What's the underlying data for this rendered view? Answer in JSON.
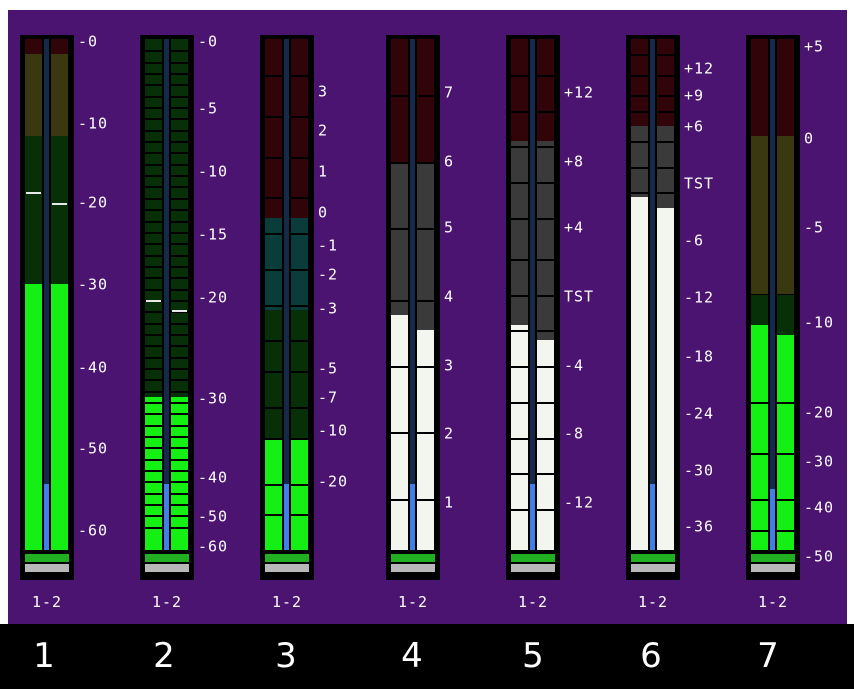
{
  "colors": {
    "background": "#4b1470",
    "footer": "#000000",
    "green_active": "#14f014",
    "white_active": "#f2f6ee",
    "peak_blue": "#3f7fe6",
    "dark_red": "#300408",
    "dark_olive": "#3a3810",
    "dark_green": "#083008",
    "dark_teal": "#0a3c3c",
    "dark_gray": "#3a3a3a"
  },
  "meters": [
    {
      "track": "1",
      "channel_label": "1-2",
      "scale": [
        "-0",
        "-10",
        "-20",
        "-30",
        "-40",
        "-50",
        "-60"
      ],
      "left_level": 0.52,
      "right_level": 0.52,
      "left_peak": 0.7,
      "right_peak": 0.68,
      "center_peak": 0.13
    },
    {
      "track": "2",
      "channel_label": "2",
      "channel_text": "1-2",
      "scale": [
        "-0",
        "-5",
        "-10",
        "-15",
        "-20",
        "-30",
        "-40",
        "-50",
        "-60"
      ],
      "left_level": 0.3,
      "right_level": 0.3,
      "left_peak": 0.49,
      "right_peak": 0.47,
      "center_peak": 0.13
    },
    {
      "track": "3",
      "channel_text": "1-2",
      "scale": [
        "3",
        "2",
        "1",
        "0",
        "-1",
        "-2",
        "-3",
        "-5",
        "-7",
        "-10",
        "-20"
      ],
      "left_level": 0.22,
      "right_level": 0.22,
      "center_peak": 0.13
    },
    {
      "track": "4",
      "channel_text": "1-2",
      "scale": [
        "7",
        "6",
        "5",
        "4",
        "3",
        "2",
        "1"
      ],
      "left_level": 0.46,
      "right_level": 0.43,
      "center_peak": 0.13
    },
    {
      "track": "5",
      "channel_text": "1-2",
      "scale": [
        "+12",
        "+8",
        "+4",
        "TST",
        "-4",
        "-8",
        "-12"
      ],
      "left_level": 0.44,
      "right_level": 0.41,
      "center_peak": 0.13
    },
    {
      "track": "6",
      "channel_text": "1-2",
      "scale": [
        "+12",
        "+9",
        "+6",
        "TST",
        "-6",
        "-12",
        "-18",
        "-24",
        "-30",
        "-36"
      ],
      "left_level": 0.69,
      "right_level": 0.67,
      "center_peak": 0.13
    },
    {
      "track": "7",
      "channel_text": "1-2",
      "scale": [
        "+5",
        "0",
        "-5",
        "-10",
        "-20",
        "-30",
        "-40",
        "-50"
      ],
      "left_level": 0.44,
      "right_level": 0.42,
      "center_peak": 0.12
    }
  ]
}
